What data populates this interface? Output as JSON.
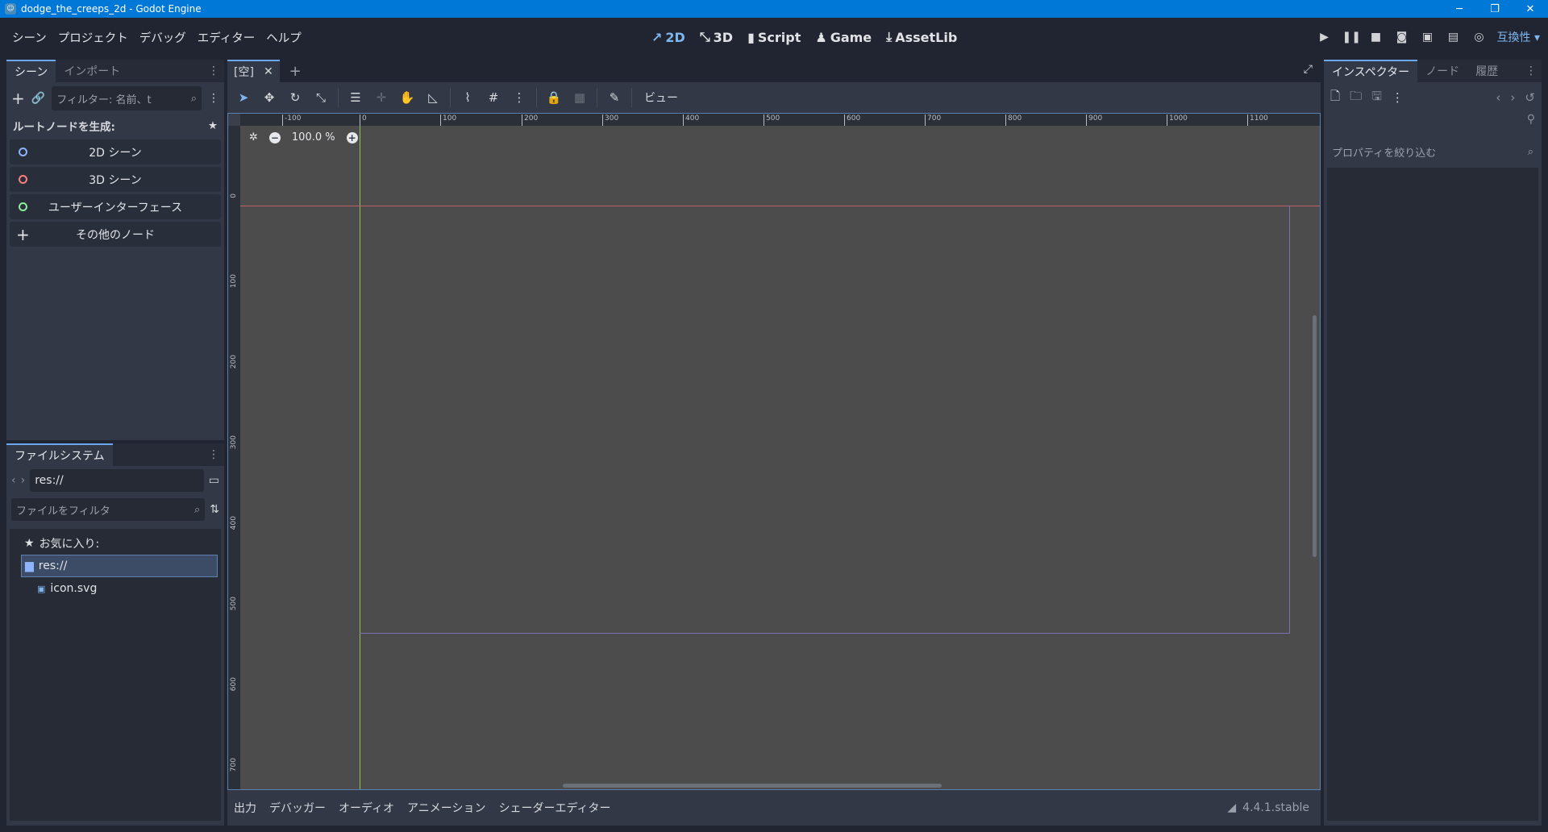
{
  "window": {
    "title": "dodge_the_creeps_2d - Godot Engine",
    "minimize": "─",
    "restore": "❐",
    "close": "✕"
  },
  "menu": [
    "シーン",
    "プロジェクト",
    "デバッグ",
    "エディター",
    "ヘルプ"
  ],
  "workspaces": [
    {
      "label": "2D",
      "icon": "↗",
      "active": true
    },
    {
      "label": "3D",
      "icon": "⤡",
      "active": false
    },
    {
      "label": "Script",
      "icon": "▮",
      "active": false
    },
    {
      "label": "Game",
      "icon": "♟",
      "active": false
    },
    {
      "label": "AssetLib",
      "icon": "⤓",
      "active": false
    }
  ],
  "run": {
    "compat_label": "互換性 ▾"
  },
  "scene_dock": {
    "tabs": [
      "シーン",
      "インポート"
    ],
    "filter_placeholder": "フィルター: 名前、t",
    "root_title": "ルートノードを生成:",
    "root_buttons": [
      {
        "label": "2D シーン",
        "color": "#8fb4ff"
      },
      {
        "label": "3D シーン",
        "color": "#fc7f7f"
      },
      {
        "label": "ユーザーインターフェース",
        "color": "#8eef97"
      },
      {
        "label": "その他のノード",
        "color": ""
      }
    ]
  },
  "fs_dock": {
    "tab": "ファイルシステム",
    "path": "res://",
    "filter_placeholder": "ファイルをフィルタ",
    "favorites": "お気に入り:",
    "root": "res://",
    "file": "icon.svg"
  },
  "editor": {
    "scene_tab": "[空]",
    "view_menu": "ビュー",
    "zoom": "100.0 %",
    "ruler_top": [
      "-100",
      "0",
      "100",
      "200",
      "300",
      "400",
      "500",
      "600",
      "700",
      "800",
      "900",
      "1000",
      "1100"
    ],
    "ruler_left": [
      "0",
      "100",
      "200",
      "300",
      "400",
      "500",
      "600",
      "700"
    ]
  },
  "bottom_tabs": [
    "出力",
    "デバッガー",
    "オーディオ",
    "アニメーション",
    "シェーダーエディター"
  ],
  "version": "4.4.1.stable",
  "inspector": {
    "tabs": [
      "インスペクター",
      "ノード",
      "履歴"
    ],
    "filter_placeholder": "プロパティを絞り込む"
  }
}
